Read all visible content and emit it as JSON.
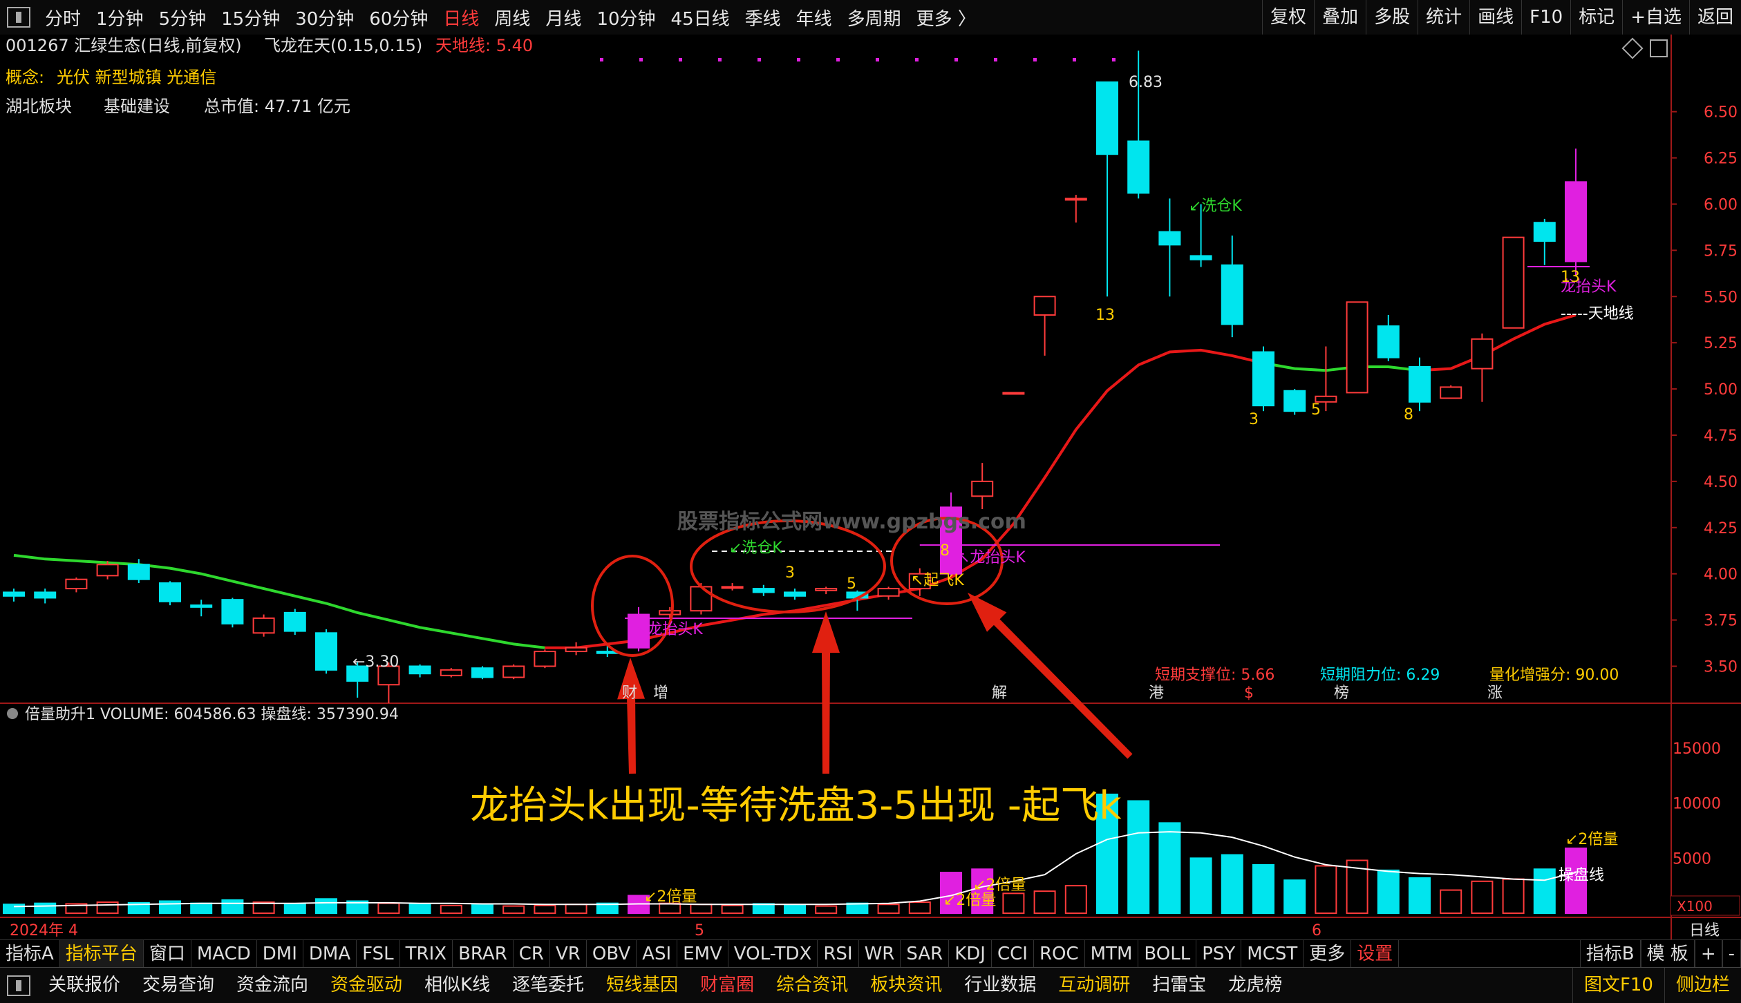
{
  "top_tabs": [
    "分时",
    "1分钟",
    "5分钟",
    "15分钟",
    "30分钟",
    "60分钟",
    "日线",
    "周线",
    "月线",
    "10分钟",
    "45日线",
    "季线",
    "年线",
    "多周期",
    "更多 〉"
  ],
  "active_tab": "日线",
  "top_right": [
    "复权",
    "叠加",
    "多股",
    "统计",
    "画线",
    "F10",
    "标记",
    "+自选",
    "返回"
  ],
  "header": {
    "code_name": "001267 汇绿生态(日线,前复权)",
    "indicator": "飞龙在天(0.15,0.15)",
    "tdline": "天地线: 5.40"
  },
  "concept": {
    "label": "概念:",
    "value": "光伏 新型城镇 光通信"
  },
  "info": {
    "sector": "湖北板块",
    "field": "基础建设",
    "mcap": "总市值: 47.71 亿元"
  },
  "stats": {
    "support": "短期支撑位: 5.66",
    "resist": "短期阻力位: 6.29",
    "score": "量化增强分: 90.00"
  },
  "watermark": "股票指标公式网www.gpzbgs.com",
  "sub_header": "倍量助升1 VOLUME: 604586.63 操盘线: 357390.94",
  "annotation_big": "龙抬头k出现-等待洗盘3-5出现 -起飞k",
  "labels": {
    "high": "6.83",
    "low": "←3.30",
    "xipan1": "↙洗仓K",
    "xipan2": "↙洗仓K",
    "lt1": "↖龙抬头K",
    "lt2": "龙抬头K",
    "lt3": "↖龙抬头K",
    "qifei": "↖起飞K",
    "tdl": "-----天地线",
    "n13a": "13",
    "n13b": "13",
    "n3a": "3",
    "n5a": "5",
    "n3b": "3",
    "n5b": "5",
    "n8a": "8",
    "n8b": "8",
    "bei1": "↙2倍量",
    "bei2": "↙2倍量",
    "bei3": "↙2倍量",
    "bei4": "↙2倍量",
    "cpx": "操盘线",
    "x100": "X100",
    "d2024": "2024年 4",
    "m5": "5",
    "m6": "6",
    "period": "日线"
  },
  "events": [
    "财",
    "增",
    "解",
    "港",
    "$",
    "榜",
    "涨"
  ],
  "price_axis": [
    "6.50",
    "6.25",
    "6.00",
    "5.75",
    "5.50",
    "5.25",
    "5.00",
    "4.75",
    "4.50",
    "4.25",
    "4.00",
    "3.75",
    "3.50"
  ],
  "vol_axis": [
    "15000",
    "10000",
    "5000"
  ],
  "indicator_tabs": [
    "指标A",
    "指标平台",
    "窗口",
    "MACD",
    "DMI",
    "DMA",
    "FSL",
    "TRIX",
    "BRAR",
    "CR",
    "VR",
    "OBV",
    "ASI",
    "EMV",
    "VOL-TDX",
    "RSI",
    "WR",
    "SAR",
    "KDJ",
    "CCI",
    "ROC",
    "MTM",
    "BOLL",
    "PSY",
    "MCST",
    "更多",
    "设置"
  ],
  "indicator_right": [
    "指标B",
    "模 板",
    "+",
    "-"
  ],
  "bottom_tabs": [
    "关联报价",
    "交易查询",
    "资金流向",
    "资金驱动",
    "相似K线",
    "逐笔委托",
    "短线基因",
    "财富圈",
    "综合资讯",
    "板块资讯",
    "行业数据",
    "互动调研",
    "扫雷宝",
    "龙虎榜"
  ],
  "bottom_right": [
    "图文F10",
    "侧边栏"
  ],
  "colors": {
    "up": "#ff3b3b",
    "down": "#00e5ee",
    "ma_green": "#2ed82e",
    "ma_red": "#e81818",
    "magenta": "#e020e0",
    "yellow": "#ffcc00",
    "circle": "#e02010"
  },
  "chart_data": {
    "type": "candlestick",
    "ylim": [
      3.3,
      6.85
    ],
    "candles": [
      {
        "o": 3.9,
        "c": 3.88,
        "h": 3.92,
        "l": 3.85
      },
      {
        "o": 3.9,
        "c": 3.87,
        "h": 3.92,
        "l": 3.84
      },
      {
        "o": 3.92,
        "c": 3.97,
        "h": 3.98,
        "l": 3.9
      },
      {
        "o": 3.99,
        "c": 4.05,
        "h": 4.07,
        "l": 3.97
      },
      {
        "o": 4.05,
        "c": 3.97,
        "h": 4.08,
        "l": 3.95
      },
      {
        "o": 3.95,
        "c": 3.85,
        "h": 3.96,
        "l": 3.83
      },
      {
        "o": 3.83,
        "c": 3.82,
        "h": 3.86,
        "l": 3.77
      },
      {
        "o": 3.86,
        "c": 3.73,
        "h": 3.87,
        "l": 3.71
      },
      {
        "o": 3.68,
        "c": 3.76,
        "h": 3.78,
        "l": 3.66
      },
      {
        "o": 3.79,
        "c": 3.69,
        "h": 3.81,
        "l": 3.67
      },
      {
        "o": 3.68,
        "c": 3.48,
        "h": 3.7,
        "l": 3.46
      },
      {
        "o": 3.5,
        "c": 3.42,
        "h": 3.52,
        "l": 3.33
      },
      {
        "o": 3.4,
        "c": 3.5,
        "h": 3.52,
        "l": 3.3
      },
      {
        "o": 3.5,
        "c": 3.46,
        "h": 3.51,
        "l": 3.44
      },
      {
        "o": 3.45,
        "c": 3.48,
        "h": 3.49,
        "l": 3.44
      },
      {
        "o": 3.49,
        "c": 3.44,
        "h": 3.5,
        "l": 3.43
      },
      {
        "o": 3.44,
        "c": 3.5,
        "h": 3.51,
        "l": 3.43
      },
      {
        "o": 3.5,
        "c": 3.58,
        "h": 3.59,
        "l": 3.49
      },
      {
        "o": 3.58,
        "c": 3.6,
        "h": 3.63,
        "l": 3.56
      },
      {
        "o": 3.58,
        "c": 3.57,
        "h": 3.62,
        "l": 3.55
      },
      {
        "o": 3.6,
        "c": 3.78,
        "h": 3.82,
        "l": 3.58
      },
      {
        "o": 3.78,
        "c": 3.8,
        "h": 3.82,
        "l": 3.76
      },
      {
        "o": 3.8,
        "c": 3.93,
        "h": 3.95,
        "l": 3.78
      },
      {
        "o": 3.93,
        "c": 3.93,
        "h": 3.95,
        "l": 3.91
      },
      {
        "o": 3.92,
        "c": 3.9,
        "h": 3.94,
        "l": 3.88
      },
      {
        "o": 3.9,
        "c": 3.88,
        "h": 3.92,
        "l": 3.86
      },
      {
        "o": 3.91,
        "c": 3.92,
        "h": 3.93,
        "l": 3.89
      },
      {
        "o": 3.9,
        "c": 3.87,
        "h": 3.91,
        "l": 3.8
      },
      {
        "o": 3.88,
        "c": 3.92,
        "h": 3.93,
        "l": 3.86
      },
      {
        "o": 3.92,
        "c": 4.0,
        "h": 4.03,
        "l": 3.88
      },
      {
        "o": 4.0,
        "c": 4.36,
        "h": 4.44,
        "l": 3.99
      },
      {
        "o": 4.42,
        "c": 4.5,
        "h": 4.6,
        "l": 4.35
      },
      {
        "o": 4.98,
        "c": 4.98,
        "h": 4.98,
        "l": 4.98
      },
      {
        "o": 5.4,
        "c": 5.5,
        "h": 5.5,
        "l": 5.18
      },
      {
        "o": 6.03,
        "c": 6.03,
        "h": 6.05,
        "l": 5.9
      },
      {
        "o": 6.66,
        "c": 6.27,
        "h": 6.66,
        "l": 5.5
      },
      {
        "o": 6.34,
        "c": 6.06,
        "h": 6.83,
        "l": 6.03
      },
      {
        "o": 5.85,
        "c": 5.78,
        "h": 6.03,
        "l": 5.5
      },
      {
        "o": 5.72,
        "c": 5.7,
        "h": 6.0,
        "l": 5.66
      },
      {
        "o": 5.67,
        "c": 5.35,
        "h": 5.83,
        "l": 5.28
      },
      {
        "o": 5.2,
        "c": 4.91,
        "h": 5.23,
        "l": 4.88
      },
      {
        "o": 4.99,
        "c": 4.88,
        "h": 5.0,
        "l": 4.86
      },
      {
        "o": 4.93,
        "c": 4.96,
        "h": 5.23,
        "l": 4.88
      },
      {
        "o": 4.98,
        "c": 5.47,
        "h": 5.47,
        "l": 4.98
      },
      {
        "o": 5.34,
        "c": 5.17,
        "h": 5.4,
        "l": 5.15
      },
      {
        "o": 5.12,
        "c": 4.93,
        "h": 5.17,
        "l": 4.88
      },
      {
        "o": 4.95,
        "c": 5.01,
        "h": 5.02,
        "l": 4.95
      },
      {
        "o": 5.11,
        "c": 5.27,
        "h": 5.3,
        "l": 4.93
      },
      {
        "o": 5.33,
        "c": 5.82,
        "h": 5.82,
        "l": 5.33
      },
      {
        "o": 5.9,
        "c": 5.8,
        "h": 5.92,
        "l": 5.67
      },
      {
        "o": 5.69,
        "c": 6.12,
        "h": 6.3,
        "l": 5.61
      }
    ],
    "ma": [
      4.1,
      4.08,
      4.07,
      4.06,
      4.05,
      4.03,
      4.0,
      3.96,
      3.92,
      3.88,
      3.84,
      3.79,
      3.75,
      3.71,
      3.68,
      3.65,
      3.62,
      3.6,
      3.6,
      3.62,
      3.64,
      3.68,
      3.72,
      3.75,
      3.78,
      3.8,
      3.83,
      3.86,
      3.89,
      3.92,
      3.98,
      4.08,
      4.27,
      4.52,
      4.78,
      4.99,
      5.13,
      5.2,
      5.21,
      5.18,
      5.14,
      5.11,
      5.1,
      5.12,
      5.12,
      5.1,
      5.11,
      5.18,
      5.27,
      5.35,
      5.4
    ],
    "volume": [
      800,
      900,
      850,
      1000,
      950,
      1100,
      900,
      1200,
      1000,
      800,
      1300,
      1100,
      900,
      800,
      700,
      750,
      650,
      700,
      800,
      900,
      1600,
      900,
      800,
      700,
      850,
      750,
      650,
      900,
      800,
      1000,
      3700,
      4000,
      1800,
      2000,
      2500,
      10800,
      10200,
      8200,
      5000,
      5300,
      4400,
      3000,
      4300,
      4800,
      3900,
      3200,
      2100,
      2900,
      3100,
      4000,
      5900
    ],
    "cpx": [
      600,
      650,
      700,
      750,
      800,
      850,
      900,
      900,
      900,
      900,
      950,
      950,
      950,
      900,
      900,
      850,
      850,
      800,
      800,
      800,
      850,
      850,
      800,
      800,
      800,
      800,
      800,
      850,
      900,
      1100,
      1600,
      2400,
      2900,
      3500,
      5400,
      6700,
      7300,
      7400,
      7300,
      6900,
      6100,
      5100,
      4400,
      4100,
      3800,
      3600,
      3500,
      3300,
      3100,
      3000,
      3700
    ],
    "vol_ylim": [
      0,
      19000
    ]
  }
}
